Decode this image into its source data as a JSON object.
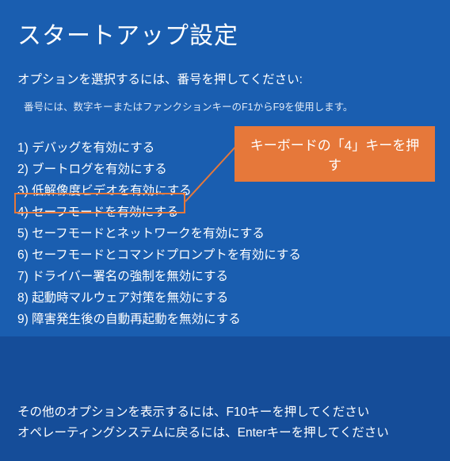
{
  "title": "スタートアップ設定",
  "instruction": "オプションを選択するには、番号を押してください:",
  "hint": "番号には、数字キーまたはファンクションキーのF1からF9を使用します。",
  "options": [
    {
      "num": "1",
      "label": "デバッグを有効にする"
    },
    {
      "num": "2",
      "label": "ブートログを有効にする"
    },
    {
      "num": "3",
      "label": "低解像度ビデオを有効にする"
    },
    {
      "num": "4",
      "label": "セーフモードを有効にする"
    },
    {
      "num": "5",
      "label": "セーフモードとネットワークを有効にする"
    },
    {
      "num": "6",
      "label": "セーフモードとコマンドプロンプトを有効にする"
    },
    {
      "num": "7",
      "label": "ドライバー署名の強制を無効にする"
    },
    {
      "num": "8",
      "label": "起動時マルウェア対策を無効にする"
    },
    {
      "num": "9",
      "label": "障害発生後の自動再起動を無効にする"
    }
  ],
  "callout": "キーボードの「4」キーを押す",
  "footer": {
    "line1": "その他のオプションを表示するには、F10キーを押してください",
    "line2": "オペレーティングシステムに戻るには、Enterキーを押してください"
  }
}
